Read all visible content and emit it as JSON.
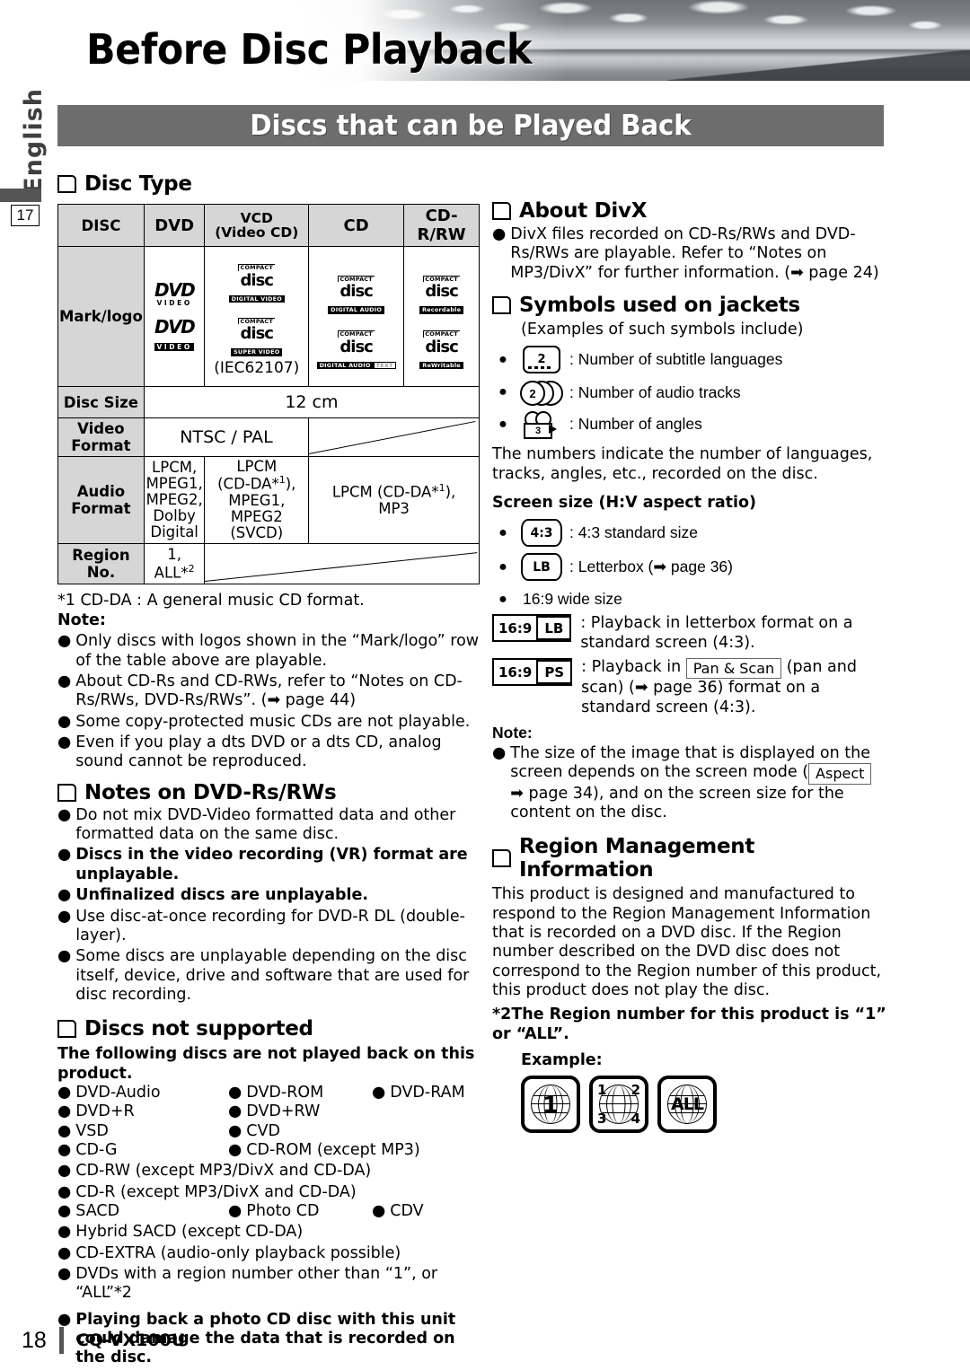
{
  "header": {
    "title": "Before Disc Playback",
    "band_title": "Discs that can be Played Back",
    "language_tab": "English",
    "section_number": "17"
  },
  "left": {
    "disc_type_heading": "Disc Type",
    "table": {
      "columns": [
        "DISC",
        "DVD",
        "VCD",
        "CD",
        "CD-R/RW"
      ],
      "vcd_sub": "(Video CD)",
      "rows": {
        "mark_logo_label": "Mark/logo",
        "mark_logo": {
          "dvd": [
            "DVD VIDEO",
            "DVD VIDEO"
          ],
          "vcd": [
            "COMPACT disc DIGITAL VIDEO",
            "COMPACT disc SUPER VIDEO",
            "(IEC62107)"
          ],
          "cd": [
            "COMPACT disc DIGITAL AUDIO",
            "COMPACT disc DIGITAL AUDIO TEXT"
          ],
          "cdrrw": [
            "COMPACT disc Recordable",
            "COMPACT disc ReWritable"
          ]
        },
        "disc_size_label": "Disc Size",
        "disc_size_value": "12 cm",
        "video_format_label": "Video Format",
        "video_format_value": "NTSC / PAL",
        "audio_format_label": "Audio Format",
        "audio_dvd": "LPCM, MPEG1, MPEG2, Dolby Digital",
        "audio_vcd": "LPCM (CD-DA*1), MPEG1, MPEG2 (SVCD)",
        "audio_cd": "LPCM (CD-DA*1), MP3",
        "region_no_label": "Region No.",
        "region_no_value": "1, ALL*2"
      }
    },
    "footnote1": "*1 CD-DA : A general music CD format.",
    "note_label": "Note:",
    "notes": [
      "Only discs with logos shown in the “Mark/logo” row of the table above are playable.",
      "About CD-Rs and CD-RWs, refer to “Notes on CD-Rs/RWs, DVD-Rs/RWs”. (➡ page 44)",
      "Some copy-protected music CDs are not playable.",
      "Even if you play a dts DVD or a dts CD, analog sound cannot be reproduced."
    ],
    "dvdr_heading": "Notes on DVD-Rs/RWs",
    "dvdr_notes": [
      {
        "text": "Do not mix DVD-Video formatted data and other formatted data on the same disc.",
        "bold": false
      },
      {
        "text": "Discs in the video recording (VR) format are unplayable.",
        "bold": true
      },
      {
        "text": "Unfinalized discs are unplayable.",
        "bold": true
      },
      {
        "text": "Use disc-at-once recording for DVD-R DL (double-layer).",
        "bold": false
      },
      {
        "text": "Some discs are unplayable depending on the disc itself, device, drive and software that are used for disc recording.",
        "bold": false
      }
    ],
    "unsupported_heading": "Discs not supported",
    "unsupported_intro": "The following discs are not played back on this product.",
    "unsupported_rows": [
      [
        "DVD-Audio",
        "DVD-ROM",
        "DVD-RAM"
      ],
      [
        "DVD+R",
        "DVD+RW",
        ""
      ],
      [
        "VSD",
        "CVD",
        ""
      ],
      [
        "CD-G",
        "CD-ROM (except MP3)",
        ""
      ],
      [
        "CD-RW (except MP3/DivX and CD-DA)",
        "",
        ""
      ],
      [
        "CD-R (except MP3/DivX and CD-DA)",
        "",
        ""
      ],
      [
        "SACD",
        "Photo CD",
        "CDV"
      ],
      [
        "Hybrid SACD (except CD-DA)",
        "",
        ""
      ],
      [
        "CD-EXTRA (audio-only playback possible)",
        "",
        ""
      ],
      [
        "DVDs with a region number other than “1”, or “ALL”*2",
        "",
        ""
      ]
    ],
    "photo_cd_warning": "Playing back a photo CD disc with this unit could damage the data that is recorded on the disc."
  },
  "right": {
    "divx_heading": "About DivX",
    "divx_note": "DivX files recorded on CD-Rs/RWs and DVD-Rs/RWs are playable. Refer to “Notes on MP3/DivX” for further information. (➡ page 24)",
    "symbols_heading": "Symbols used on jackets",
    "symbols_sub": "(Examples of such symbols include)",
    "symbols": [
      {
        "icon": "subtitle-icon",
        "value": "2",
        "label": ": Number of subtitle languages"
      },
      {
        "icon": "audio-tracks-icon",
        "value": "2",
        "label": ": Number of audio tracks"
      },
      {
        "icon": "angles-camera-icon",
        "value": "3",
        "label": ": Number of angles"
      }
    ],
    "symbols_footer": "The numbers indicate the number of languages, tracks, angles, etc., recorded on the disc.",
    "screen_size_heading": "Screen size (H:V aspect ratio)",
    "screen_items": [
      {
        "badge": "4:3",
        "label": ": 4:3 standard size"
      },
      {
        "badge": "LB",
        "label": ": Letterbox (➡ page 36)"
      }
    ],
    "wide_bullet": "16:9 wide size",
    "wide_items": [
      {
        "badge_a": "16:9",
        "badge_b": "LB",
        "label": ": Playback in letterbox format on a standard screen (4:3)."
      },
      {
        "badge_a": "16:9",
        "badge_b": "PS",
        "label_pre": ": Playback in ",
        "button": "Pan & Scan",
        "label_post": " (pan and scan) (➡ page 36) format on a standard screen (4:3)."
      }
    ],
    "note_label": "Note:",
    "screen_note_pre": "The size of the image that is displayed on the screen depends on the screen mode (",
    "screen_note_button": "Aspect",
    "screen_note_post": " ➡ page 34), and on the screen size for the content on the disc.",
    "region_heading": "Region Management Information",
    "region_body": "This product is designed and manufactured to respond to the Region Management Information that is recorded on a DVD disc. If the Region number described on the DVD disc does not correspond to the Region number of this product, this product does not play the disc.",
    "region_footnote": "*2The Region number for this product is “1” or “ALL”.",
    "example_label": "Example:",
    "region_globes": [
      {
        "type": "single",
        "value": "1"
      },
      {
        "type": "quad",
        "values": [
          "1",
          "2",
          "3",
          "4"
        ]
      },
      {
        "type": "all",
        "value": "ALL"
      }
    ]
  },
  "footer": {
    "page_number": "18",
    "model": "CQ-VX100U"
  }
}
